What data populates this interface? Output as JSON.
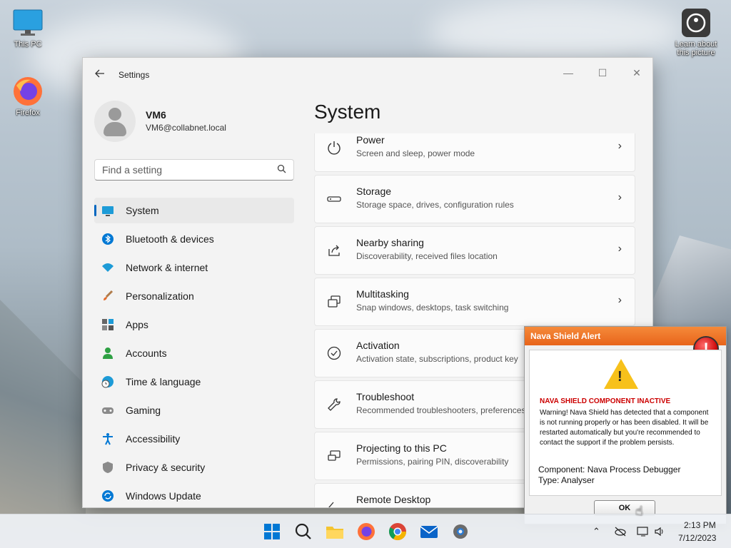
{
  "desktop": {
    "icons": [
      {
        "label": "This PC"
      },
      {
        "label": "Firefox"
      },
      {
        "label": "Learn about this picture"
      }
    ]
  },
  "window": {
    "title": "Settings",
    "controls": {
      "minimize": "—",
      "maximize": "☐",
      "close": "✕"
    }
  },
  "profile": {
    "name": "VM6",
    "email": "VM6@collabnet.local"
  },
  "search": {
    "placeholder": "Find a setting"
  },
  "sidebar": {
    "items": [
      {
        "label": "System",
        "icon": "monitor-icon",
        "active": true
      },
      {
        "label": "Bluetooth & devices",
        "icon": "bluetooth-icon"
      },
      {
        "label": "Network & internet",
        "icon": "wifi-icon"
      },
      {
        "label": "Personalization",
        "icon": "brush-icon"
      },
      {
        "label": "Apps",
        "icon": "apps-icon"
      },
      {
        "label": "Accounts",
        "icon": "person-icon"
      },
      {
        "label": "Time & language",
        "icon": "globe-clock-icon"
      },
      {
        "label": "Gaming",
        "icon": "gamepad-icon"
      },
      {
        "label": "Accessibility",
        "icon": "accessibility-icon"
      },
      {
        "label": "Privacy & security",
        "icon": "shield-icon"
      },
      {
        "label": "Windows Update",
        "icon": "update-icon"
      }
    ]
  },
  "main": {
    "heading": "System",
    "cards": [
      {
        "title": "Power",
        "subtitle": "Screen and sleep, power mode",
        "icon": "power-icon"
      },
      {
        "title": "Storage",
        "subtitle": "Storage space, drives, configuration rules",
        "icon": "storage-icon"
      },
      {
        "title": "Nearby sharing",
        "subtitle": "Discoverability, received files location",
        "icon": "share-icon"
      },
      {
        "title": "Multitasking",
        "subtitle": "Snap windows, desktops, task switching",
        "icon": "multitasking-icon"
      },
      {
        "title": "Activation",
        "subtitle": "Activation state, subscriptions, product key",
        "icon": "check-circle-icon"
      },
      {
        "title": "Troubleshoot",
        "subtitle": "Recommended troubleshooters, preferences",
        "icon": "wrench-icon"
      },
      {
        "title": "Projecting to this PC",
        "subtitle": "Permissions, pairing PIN, discoverability",
        "icon": "projector-icon"
      },
      {
        "title": "Remote Desktop",
        "subtitle": "",
        "icon": "remote-desktop-icon"
      }
    ]
  },
  "alert": {
    "title": "Nava Shield Alert",
    "heading": "NAVA SHIELD COMPONENT INACTIVE",
    "message": "Warning! Nava Shield has detected that a component is not running properly or has been disabled. It will be restarted automatically but you're recommended to contact the support if the problem persists.",
    "component": "Component: Nava Process Debugger",
    "type": "Type: Analyser",
    "ok_label": "OK"
  },
  "taskbar": {
    "time": "2:13 PM",
    "date": "7/12/2023"
  },
  "colors": {
    "accent": "#0067c0",
    "alert_header": "#e8641a",
    "alert_heading": "#cc0000"
  }
}
